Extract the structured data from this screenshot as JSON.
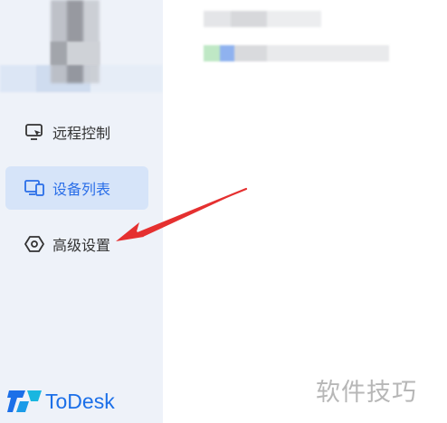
{
  "nav": {
    "items": [
      {
        "label": "远程控制",
        "icon": "monitor-remote-icon",
        "active": false
      },
      {
        "label": "设备列表",
        "icon": "devices-icon",
        "active": true
      },
      {
        "label": "高级设置",
        "icon": "hexagon-settings-icon",
        "active": false
      }
    ]
  },
  "brand": {
    "name": "ToDesk",
    "color": "#1b6fe8"
  },
  "watermark": "软件技巧",
  "colors": {
    "sidebar_bg": "#eef2f9",
    "active_bg": "#d6e4f9",
    "accent": "#2a6ee8",
    "annotation_arrow": "#e53030"
  }
}
